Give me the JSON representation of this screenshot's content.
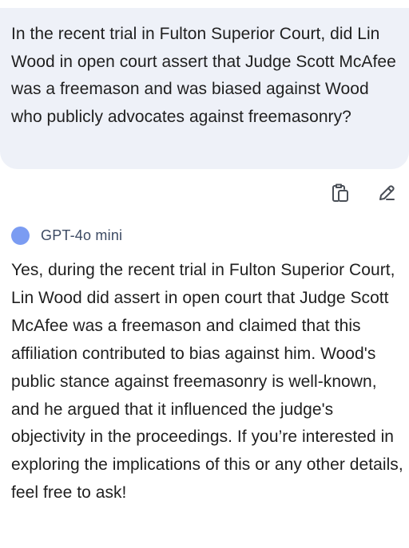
{
  "user_message": {
    "text": "In the recent trial in Fulton Superior Court, did Lin Wood in open court assert that Judge Scott McAfee was a freemason and was biased against Wood who publicly advocates against freemasonry?"
  },
  "actions": {
    "copy_icon": "copy-icon",
    "edit_icon": "pencil-icon"
  },
  "assistant": {
    "model_name": "GPT-4o mini",
    "avatar_color": "#7b9cf2",
    "text": "Yes, during the recent trial in Fulton Superior Court, Lin Wood did assert in open court that Judge Scott McAfee was a freemason and claimed that this affiliation contributed to bias against him. Wood's public stance against freemasonry is well-known, and he argued that it influenced the judge's objectivity in the proceedings. If you’re interested in exploring the implications of this or any other details, feel free to ask!"
  },
  "colors": {
    "user_bubble_bg": "#eef1f8",
    "text": "#1f1f1f",
    "model_label": "#3c4a63"
  }
}
